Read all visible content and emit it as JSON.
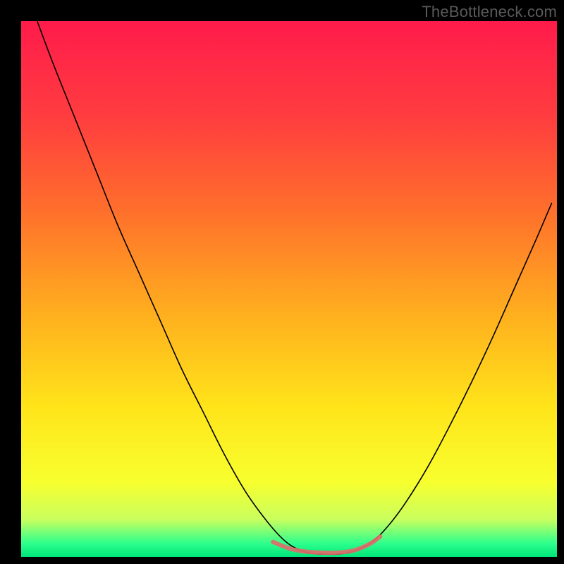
{
  "watermark": "TheBottleneck.com",
  "chart_data": {
    "type": "line",
    "title": "",
    "xlabel": "",
    "ylabel": "",
    "xlim": [
      0,
      100
    ],
    "ylim": [
      0,
      100
    ],
    "grid": false,
    "legend": false,
    "background_gradient_stops": [
      {
        "offset": 0.0,
        "color": "#ff1b4b"
      },
      {
        "offset": 0.18,
        "color": "#ff3d3f"
      },
      {
        "offset": 0.35,
        "color": "#ff6e2c"
      },
      {
        "offset": 0.55,
        "color": "#ffb01e"
      },
      {
        "offset": 0.72,
        "color": "#ffe41a"
      },
      {
        "offset": 0.86,
        "color": "#f8ff2e"
      },
      {
        "offset": 0.93,
        "color": "#c9ff5e"
      },
      {
        "offset": 0.975,
        "color": "#2dff8d"
      },
      {
        "offset": 1.0,
        "color": "#00e57a"
      }
    ],
    "series": [
      {
        "name": "bottleneck-curve",
        "color": "#000000",
        "width": 1.6,
        "points": [
          {
            "x": 3.0,
            "y": 100.0
          },
          {
            "x": 6.0,
            "y": 92.0
          },
          {
            "x": 10.0,
            "y": 82.0
          },
          {
            "x": 14.0,
            "y": 72.0
          },
          {
            "x": 18.0,
            "y": 62.0
          },
          {
            "x": 22.0,
            "y": 53.0
          },
          {
            "x": 26.0,
            "y": 44.0
          },
          {
            "x": 30.0,
            "y": 35.0
          },
          {
            "x": 34.0,
            "y": 27.0
          },
          {
            "x": 38.0,
            "y": 19.0
          },
          {
            "x": 42.0,
            "y": 12.0
          },
          {
            "x": 46.0,
            "y": 6.5
          },
          {
            "x": 49.0,
            "y": 3.2
          },
          {
            "x": 51.5,
            "y": 1.5
          },
          {
            "x": 54.0,
            "y": 0.7
          },
          {
            "x": 57.0,
            "y": 0.5
          },
          {
            "x": 60.0,
            "y": 0.6
          },
          {
            "x": 63.0,
            "y": 1.4
          },
          {
            "x": 66.0,
            "y": 3.2
          },
          {
            "x": 69.0,
            "y": 6.4
          },
          {
            "x": 72.0,
            "y": 10.5
          },
          {
            "x": 76.0,
            "y": 17.0
          },
          {
            "x": 80.0,
            "y": 24.5
          },
          {
            "x": 84.0,
            "y": 32.5
          },
          {
            "x": 88.0,
            "y": 41.0
          },
          {
            "x": 92.0,
            "y": 50.0
          },
          {
            "x": 96.0,
            "y": 59.0
          },
          {
            "x": 99.0,
            "y": 66.0
          }
        ]
      },
      {
        "name": "flat-accent",
        "color": "#e06d6b",
        "width": 6,
        "points": [
          {
            "x": 47.0,
            "y": 2.8
          },
          {
            "x": 50.0,
            "y": 1.6
          },
          {
            "x": 53.0,
            "y": 1.0
          },
          {
            "x": 56.0,
            "y": 0.8
          },
          {
            "x": 59.0,
            "y": 0.8
          },
          {
            "x": 62.0,
            "y": 1.2
          },
          {
            "x": 65.0,
            "y": 2.4
          },
          {
            "x": 67.0,
            "y": 3.8
          }
        ]
      }
    ]
  }
}
